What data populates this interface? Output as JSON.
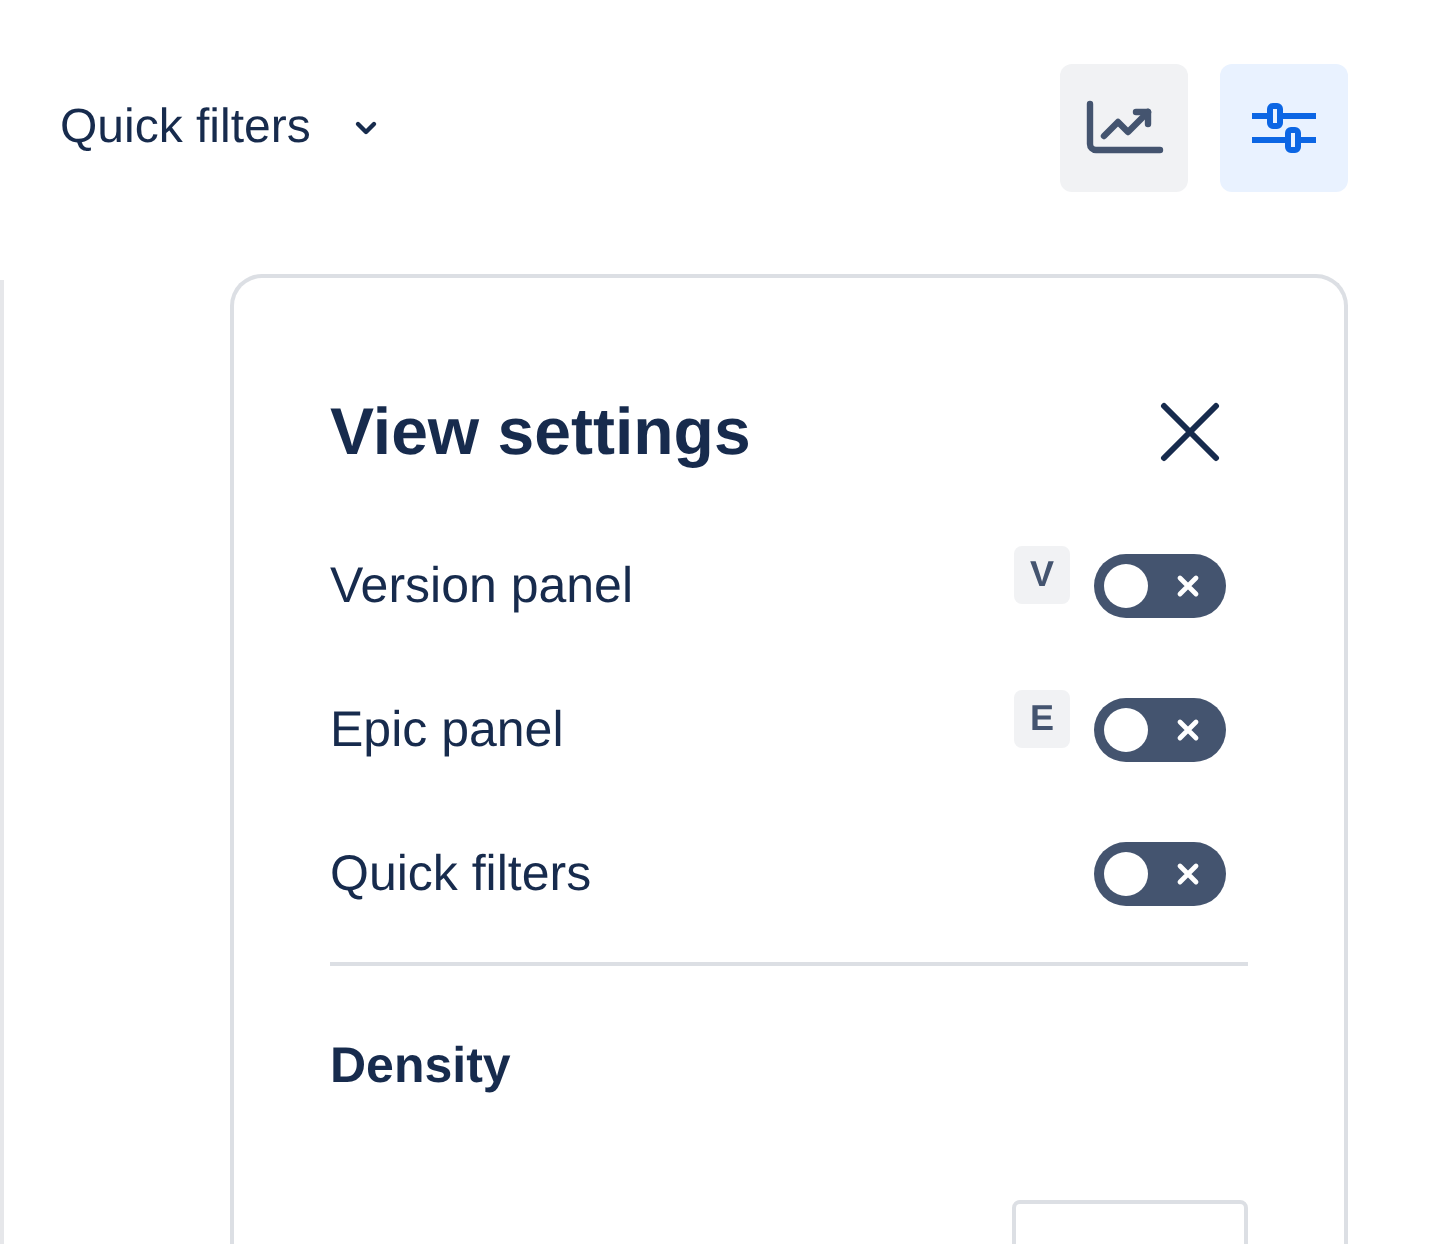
{
  "quick_filters": {
    "label": "Quick filters"
  },
  "toolbar": [
    {
      "kind": "insights",
      "selected": false
    },
    {
      "kind": "settings",
      "selected": true
    }
  ],
  "panel": {
    "title": "View settings",
    "toggles": [
      {
        "label": "Version panel",
        "shortcut": "V",
        "on": false
      },
      {
        "label": "Epic panel",
        "shortcut": "E",
        "on": false
      },
      {
        "label": "Quick filters",
        "on": false
      }
    ],
    "section": "Density"
  }
}
